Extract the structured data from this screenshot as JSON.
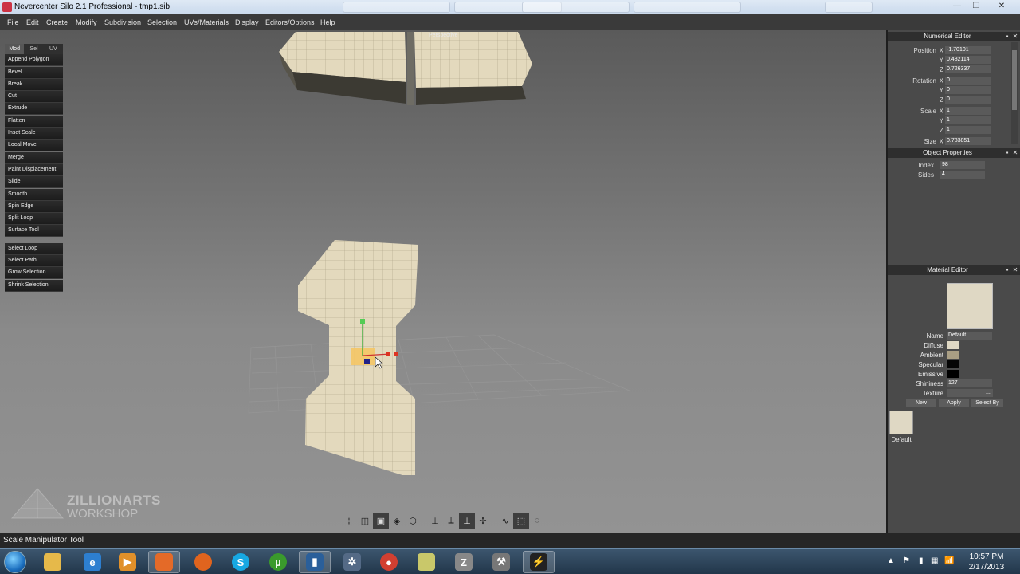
{
  "window": {
    "title": "Nevercenter Silo 2.1 Professional - tmp1.sib",
    "controls": [
      "—",
      "❐",
      "✕"
    ]
  },
  "menu": [
    "File",
    "Edit",
    "Create",
    "Modify",
    "Subdivision",
    "Selection",
    "UVs/Materials",
    "Display",
    "Editors/Options",
    "Help"
  ],
  "viewport": {
    "label": "Perspective"
  },
  "tools": {
    "tabs": [
      "Mod",
      "Sel",
      "UV"
    ],
    "active_tab": "Mod",
    "modify": [
      "Append Polygon",
      "Bevel",
      "Break",
      "Cut",
      "Extrude",
      "Flatten",
      "Inset Scale",
      "Local Move",
      "Merge",
      "Paint Displacement",
      "Slide",
      "Smooth",
      "Spin Edge",
      "Split Loop",
      "Surface Tool"
    ],
    "select": [
      "Select Loop",
      "Select Path",
      "Grow Selection",
      "Shrink Selection"
    ]
  },
  "numerical_editor": {
    "title": "Numerical Editor",
    "position_label": "Position",
    "rotation_label": "Rotation",
    "scale_label": "Scale",
    "size_label": "Size",
    "position": {
      "x": "-1.70101",
      "y": "0.482114",
      "z": "0.726337"
    },
    "rotation": {
      "x": "0",
      "y": "0",
      "z": "0"
    },
    "scale": {
      "x": "1",
      "y": "1",
      "z": "1"
    },
    "size": {
      "x": "0.783851"
    },
    "axis": {
      "x": "X",
      "y": "Y",
      "z": "Z"
    }
  },
  "object_properties": {
    "title": "Object Properties",
    "index_label": "Index",
    "index": "98",
    "sides_label": "Sides",
    "sides": "4"
  },
  "material_editor": {
    "title": "Material Editor",
    "name_label": "Name",
    "name": "Default",
    "diffuse_label": "Diffuse",
    "ambient_label": "Ambient",
    "specular_label": "Specular",
    "emissive_label": "Emissive",
    "shininess_label": "Shininess",
    "shininess": "127",
    "texture_label": "Texture",
    "texture_button": "...",
    "buttons": [
      "New",
      "Apply",
      "Select By"
    ],
    "thumb_label": "Default",
    "colors": {
      "diffuse": "#dfd8c4",
      "ambient": "#a99e84",
      "specular": "#050505",
      "emissive": "#000000"
    }
  },
  "watermark": {
    "line1": "ZILLIONARTS",
    "line2": "WORKSHOP"
  },
  "status": "Scale Manipulator Tool",
  "clock": {
    "time": "10:57 PM",
    "date": "2/17/2013"
  },
  "tray": [
    "▲",
    "⚑",
    "▮",
    "▦",
    "📶",
    "🔊"
  ],
  "taskbar_apps": [
    "explorer-icon",
    "ie-icon",
    "media-player-icon",
    "app-icon",
    "firefox-icon",
    "skype-icon",
    "utorrent-icon",
    "app-icon",
    "settings-icon",
    "chrome-icon",
    "notes-icon",
    "zbrush-icon",
    "tools-icon",
    "silo-icon"
  ]
}
